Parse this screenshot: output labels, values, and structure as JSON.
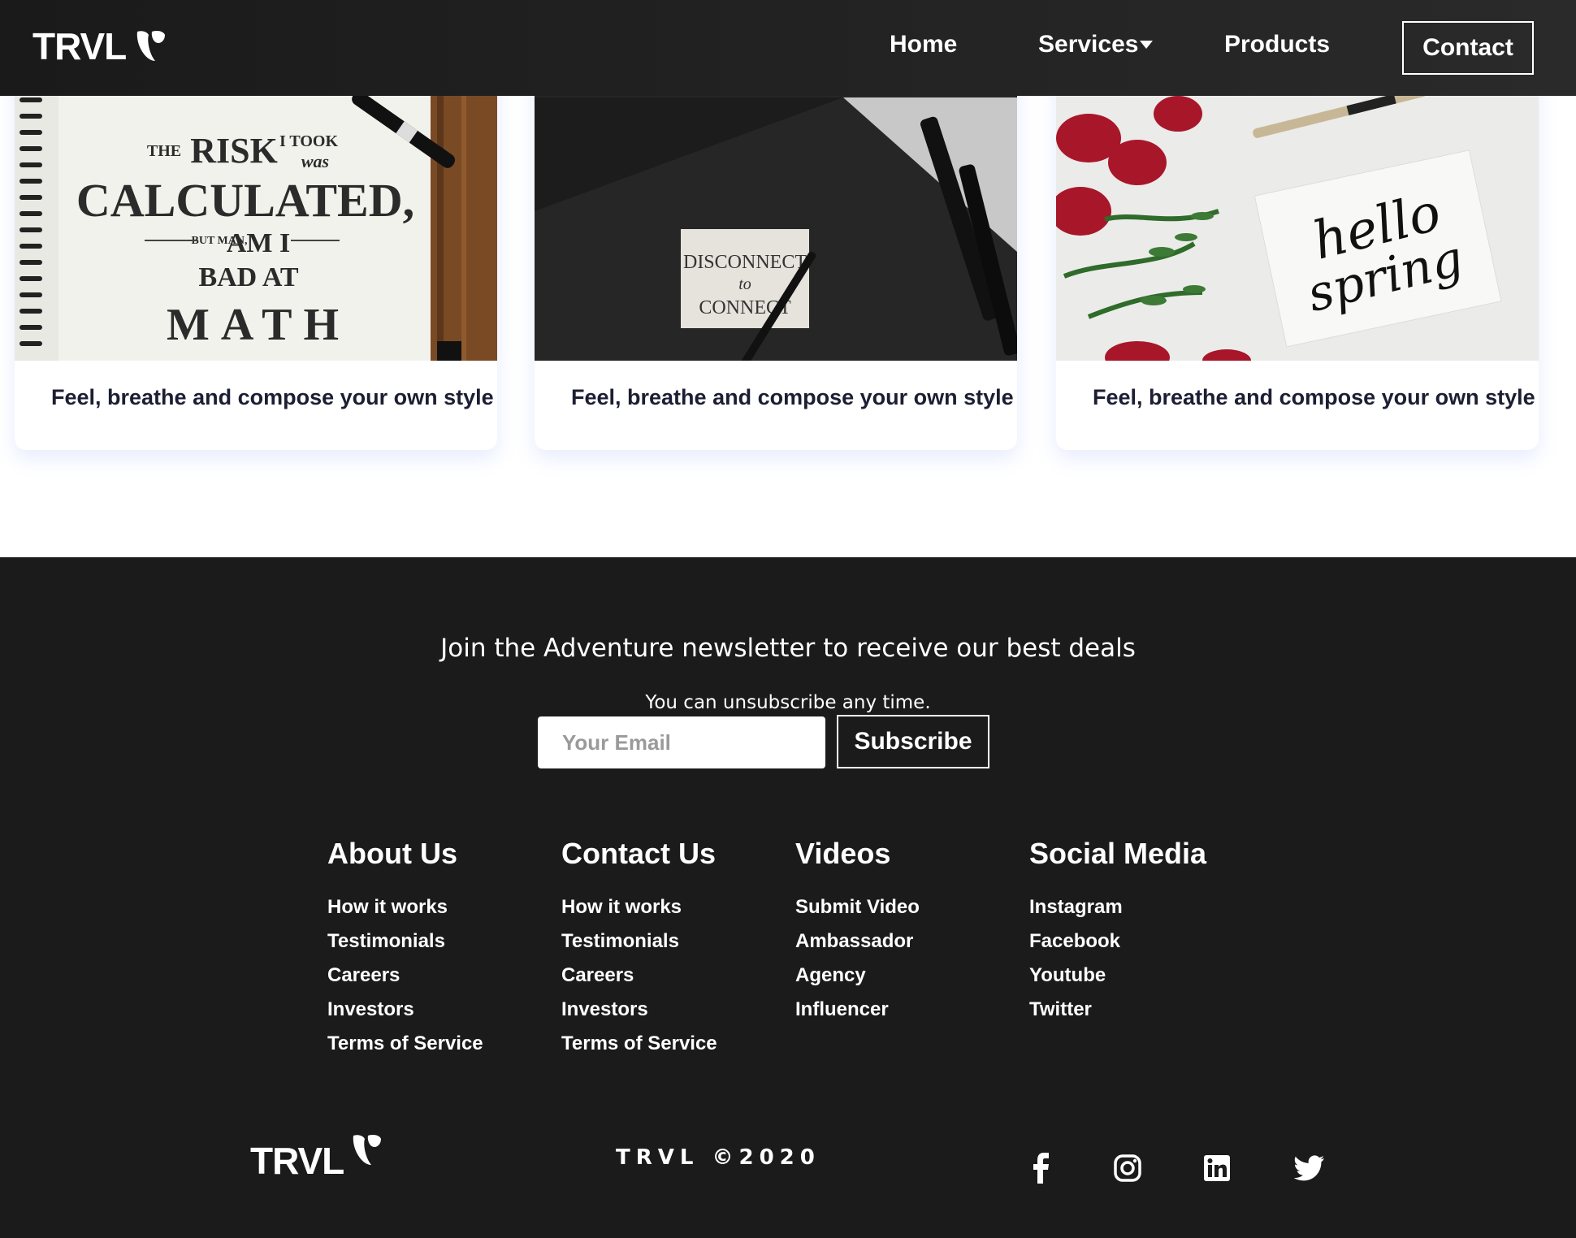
{
  "header": {
    "brand": "TRVL",
    "nav": {
      "home": "Home",
      "services": "Services",
      "products": "Products",
      "contact": "Contact"
    }
  },
  "cards": [
    {
      "title": "Feel, breathe and compose your own style",
      "image_text": [
        "THE",
        "RISK",
        "I TOOK",
        "was",
        "CALCULATED,",
        "BUT MAN,",
        "AM I",
        "BAD AT",
        "MATH"
      ]
    },
    {
      "title": "Feel, breathe and compose your own style",
      "image_text": [
        "DISCONNECT",
        "to",
        "CONNECT"
      ]
    },
    {
      "title": "Feel, breathe and compose your own style",
      "image_text": [
        "hello",
        "spring"
      ]
    }
  ],
  "newsletter": {
    "title": "Join the Adventure newsletter to receive our best deals",
    "subtitle": "You can unsubscribe any time.",
    "email_placeholder": "Your Email",
    "subscribe_label": "Subscribe"
  },
  "footer_columns": [
    {
      "title": "About Us",
      "links": [
        "How it works",
        "Testimonials",
        "Careers",
        "Investors",
        "Terms of Service"
      ]
    },
    {
      "title": "Contact Us",
      "links": [
        "How it works",
        "Testimonials",
        "Careers",
        "Investors",
        "Terms of Service"
      ]
    },
    {
      "title": "Videos",
      "links": [
        "Submit Video",
        "Ambassador",
        "Agency",
        "Influencer"
      ]
    },
    {
      "title": "Social Media",
      "links": [
        "Instagram",
        "Facebook",
        "Youtube",
        "Twitter"
      ]
    }
  ],
  "footer_bottom": {
    "brand": "TRVL",
    "copyright": "TRVL ©2020",
    "social_icons": [
      "facebook-icon",
      "instagram-icon",
      "linkedin-icon",
      "twitter-icon"
    ]
  },
  "colors": {
    "nav_bg": "#1a1a1a",
    "footer_bg": "#1b1b1b",
    "card_title": "#1c1f33",
    "text_light": "#ffffff"
  }
}
